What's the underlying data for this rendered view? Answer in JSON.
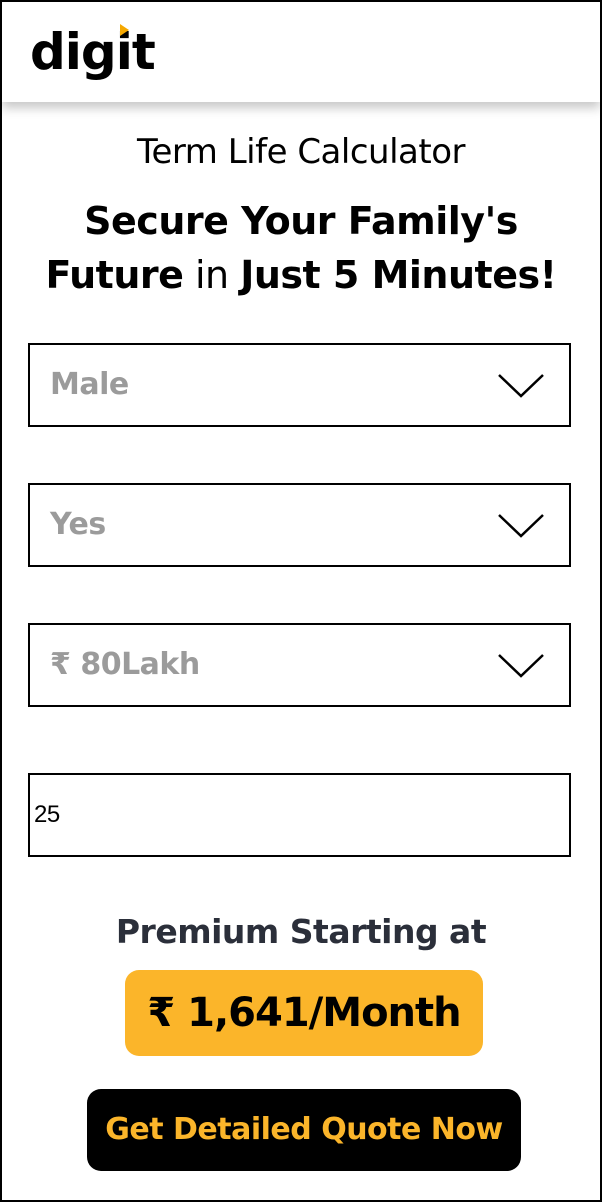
{
  "brand": {
    "logo_text": "digit",
    "accent_color": "#f5a800"
  },
  "calculator": {
    "title": "Term Life Calculator",
    "headline_part1": "Secure Your Family's",
    "headline_part2_bold": "Future",
    "headline_part2_normal": " in ",
    "headline_part3_bold": "Just 5 Minutes!"
  },
  "form": {
    "gender": {
      "value": "Male",
      "icon": "chevron-down-icon"
    },
    "smoker": {
      "value": "Yes",
      "icon": "chevron-down-icon"
    },
    "cover_amount": {
      "value": "₹ 80Lakh",
      "icon": "chevron-down-icon"
    },
    "age": {
      "value": "25"
    }
  },
  "premium": {
    "label": "Premium Starting at",
    "amount": "₹ 1,641/Month",
    "badge_color": "#fbb52a"
  },
  "cta": {
    "label": "Get Detailed Quote Now",
    "text_color": "#fbb52a",
    "background": "#000000"
  }
}
